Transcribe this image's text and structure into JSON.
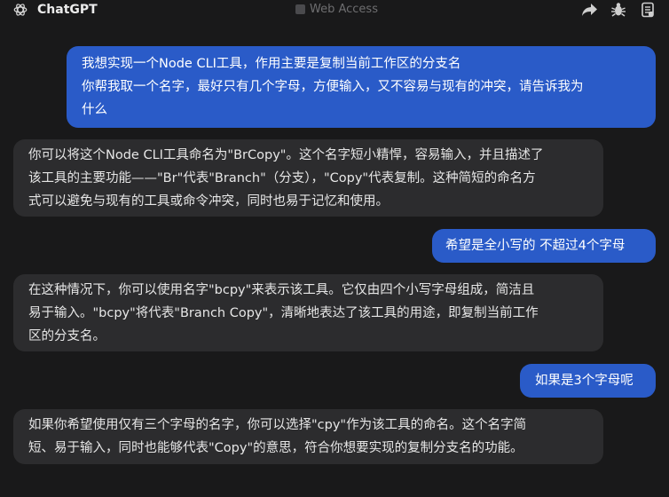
{
  "header": {
    "app_title": "ChatGPT",
    "web_access_label": "Web Access",
    "icons": [
      "chatgpt-logo-icon",
      "share-icon",
      "bug-icon",
      "notes-icon"
    ]
  },
  "messages": [
    {
      "role": "user",
      "paragraphs": [
        "我想实现一个Node CLI工具，作用主要是复制当前工作区的分支名",
        "你帮我取一个名字，最好只有几个字母，方便输入，又不容易与现有的冲突，请告诉我为\n什么"
      ]
    },
    {
      "role": "assistant",
      "text": "你可以将这个Node CLI工具命名为\"BrCopy\"。这个名字短小精悍，容易输入，并且描述了\n该工具的主要功能——\"Br\"代表\"Branch\"（分支），\"Copy\"代表复制。这种简短的命名方\n式可以避免与现有的工具或命令冲突，同时也易于记忆和使用。"
    },
    {
      "role": "user",
      "text": "希望是全小写的 不超过4个字母"
    },
    {
      "role": "assistant",
      "text": "在这种情况下，你可以使用名字\"bcpy\"来表示该工具。它仅由四个小写字母组成，简洁且\n易于输入。\"bcpy\"将代表\"Branch Copy\"，清晰地表达了该工具的用途，即复制当前工作\n区的分支名。"
    },
    {
      "role": "user",
      "text": "如果是3个字母呢"
    },
    {
      "role": "assistant",
      "text": "如果你希望使用仅有三个字母的名字，你可以选择\"cpy\"作为该工具的命名。这个名字简\n短、易于输入，同时也能够代表\"Copy\"的意思，符合你想要实现的复制分支名的功能。"
    }
  ],
  "colors": {
    "background": "#19191a",
    "user_bubble": "#2a5bc8",
    "assistant_bubble": "#2c2c2e",
    "muted_text": "#6e6e70"
  }
}
